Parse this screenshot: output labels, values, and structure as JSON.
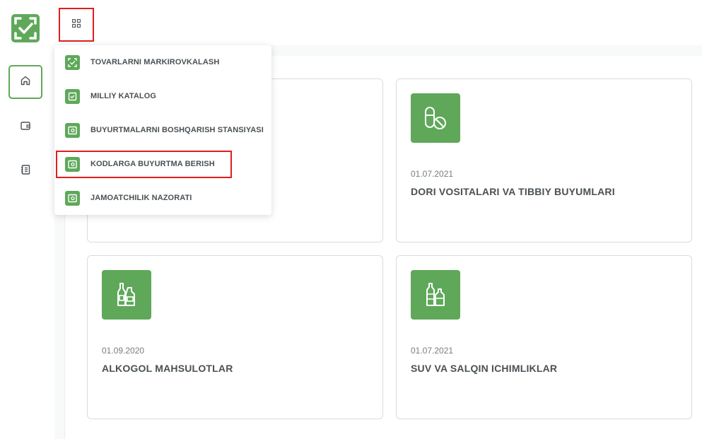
{
  "menu": {
    "items": [
      {
        "label": "TOVARLARNI MARKIROVKALASH",
        "icon": "check-frame-icon"
      },
      {
        "label": "MILLIY KATALOG",
        "icon": "catalog-icon"
      },
      {
        "label": "BUYURTMALARNI BOSHQARISH STANSIYASI",
        "icon": "wallet-icon"
      },
      {
        "label": "KODLARGA BUYURTMA BERISH",
        "icon": "wallet-icon"
      },
      {
        "label": "JAMOATCHILIK NAZORATI",
        "icon": "wallet-icon"
      }
    ],
    "highlighted_index": 3
  },
  "cards": [
    {
      "date": "01.07.2021",
      "title": "DORI VOSITALARI VA TIBBIY BUYUMLARI",
      "icon": "pill-icon"
    },
    {
      "date": "01.09.2020",
      "title": "ALKOGOL MAHSULOTLAR",
      "icon": "bottles-icon"
    },
    {
      "date": "01.07.2021",
      "title": "SUV VA SALQIN ICHIMLIKLAR",
      "icon": "water-bottles-icon"
    }
  ],
  "colors": {
    "accent": "#5fa85a",
    "highlight": "#e01e1e",
    "text": "#4a5054",
    "muted": "#777d80"
  }
}
